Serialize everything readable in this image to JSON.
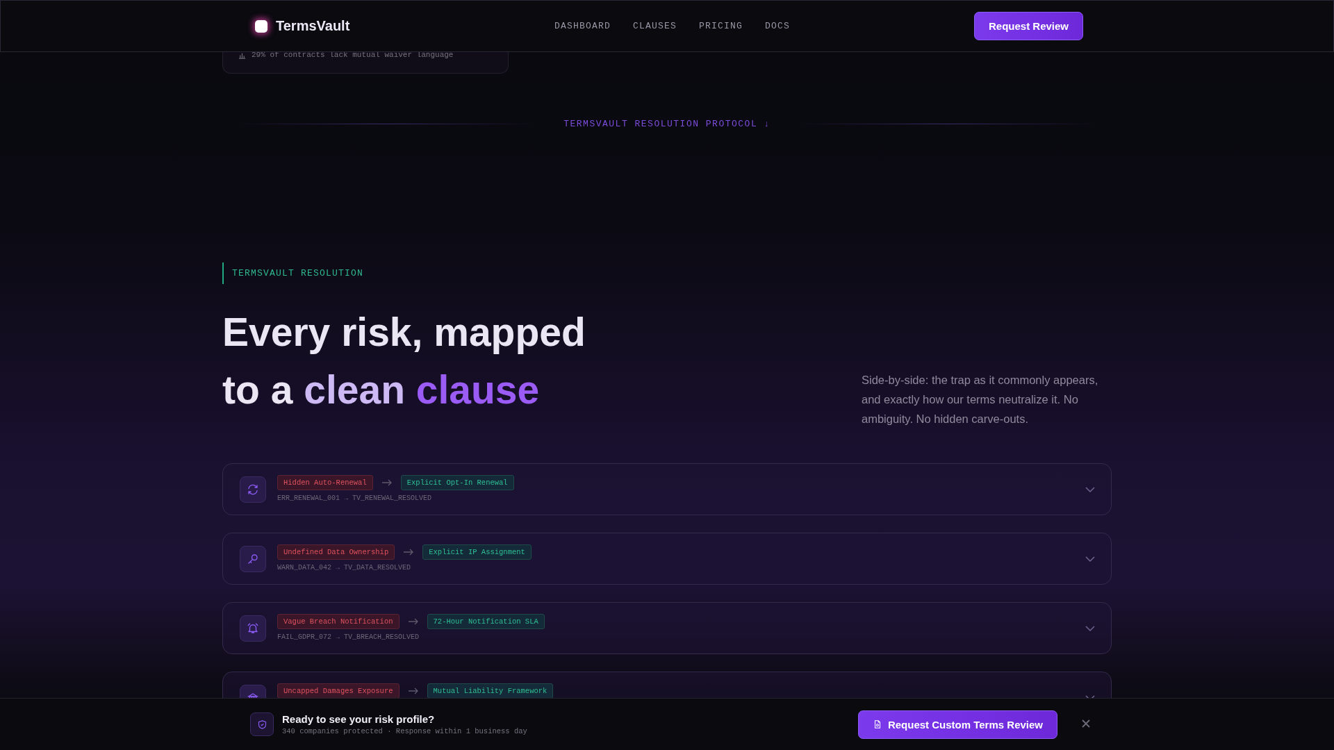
{
  "header": {
    "brand": "TermsVault",
    "nav": [
      {
        "label": "DASHBOARD"
      },
      {
        "label": "CLAUSES"
      },
      {
        "label": "PRICING"
      },
      {
        "label": "DOCS"
      }
    ],
    "cta": "Request Review"
  },
  "stat_card": {
    "text": "29% of contracts lack mutual waiver language"
  },
  "divider_label": "TERMSVAULT RESOLUTION PROTOCOL ↓",
  "section": {
    "eyebrow": "TERMSVAULT RESOLUTION",
    "headline_line1": "Every risk, mapped",
    "headline_line2": [
      {
        "text": "to a ",
        "kind": "plain"
      },
      {
        "text": "clean ",
        "kind": "soft"
      },
      {
        "text": "clause",
        "kind": "accent"
      }
    ],
    "description": "Side-by-side: the trap as it commonly appears, and exactly how our terms neutralize it. No ambiguity. No hidden carve-outs."
  },
  "rows": [
    {
      "risk": "Hidden Auto-Renewal",
      "fix": "Explicit Opt-In Renewal",
      "code": "ERR_RENEWAL_001 → TV_RENEWAL_RESOLVED",
      "expanded": false
    },
    {
      "risk": "Undefined Data Ownership",
      "fix": "Explicit IP Assignment",
      "code": "WARN_DATA_042 → TV_DATA_RESOLVED",
      "expanded": false
    },
    {
      "risk": "Vague Breach Notification",
      "fix": "72-Hour Notification SLA",
      "code": "FAIL_GDPR_072 → TV_BREACH_RESOLVED",
      "expanded": false
    },
    {
      "risk": "Uncapped Damages Exposure",
      "fix": "Mutual Liability Framework",
      "expanded": false
    }
  ],
  "bottom_bar": {
    "title": "Ready to see your risk profile?",
    "subtitle": "340 companies protected · Response within 1 business day",
    "cta": "Request Custom Terms Review"
  }
}
